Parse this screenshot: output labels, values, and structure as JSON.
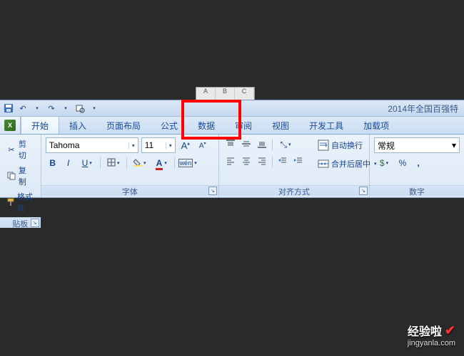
{
  "title": "2014年全国百强特",
  "sheet_cols": [
    "A",
    "B",
    "C"
  ],
  "tabs": {
    "home": "开始",
    "insert": "插入",
    "layout": "页面布局",
    "formula": "公式",
    "data": "数据",
    "review": "审阅",
    "view": "视图",
    "dev": "开发工具",
    "addin": "加载项"
  },
  "clipboard": {
    "cut": "剪切",
    "copy": "复制",
    "paint": "格式刷",
    "label": "贴板"
  },
  "font": {
    "name": "Tahoma",
    "size": "11",
    "label": "字体"
  },
  "align": {
    "wrap": "自动换行",
    "merge": "合并后居中",
    "label": "对齐方式"
  },
  "number": {
    "format": "常规",
    "label": "数字"
  },
  "watermark": {
    "main": "经验啦",
    "url": "jingyanla.com"
  }
}
